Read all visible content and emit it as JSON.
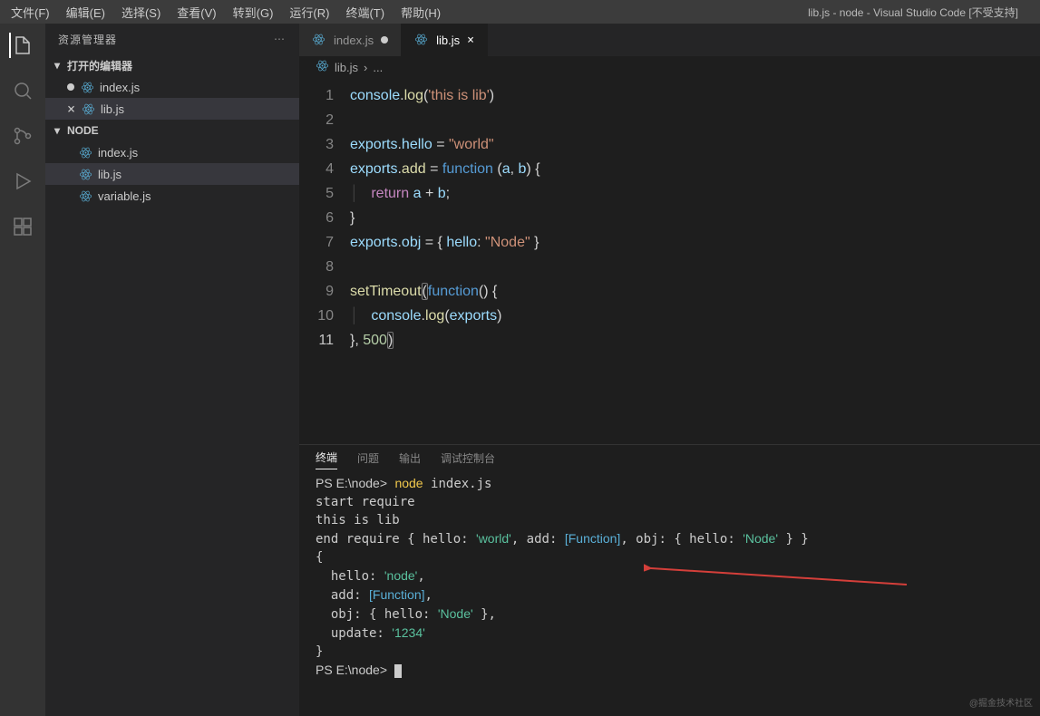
{
  "window": {
    "title": "lib.js - node - Visual Studio Code [不受支持]"
  },
  "menu": {
    "file": "文件(F)",
    "edit": "编辑(E)",
    "select": "选择(S)",
    "view": "查看(V)",
    "goto": "转到(G)",
    "run": "运行(R)",
    "terminal": "终端(T)",
    "help": "帮助(H)"
  },
  "sidebar": {
    "title": "资源管理器",
    "openEditors": {
      "label": "打开的编辑器",
      "items": [
        {
          "name": "index.js",
          "modified": true
        },
        {
          "name": "lib.js",
          "modified": false
        }
      ]
    },
    "folder": {
      "label": "NODE",
      "items": [
        {
          "name": "index.js"
        },
        {
          "name": "lib.js"
        },
        {
          "name": "variable.js"
        }
      ]
    }
  },
  "tabs": [
    {
      "name": "index.js",
      "modified": true,
      "active": false
    },
    {
      "name": "lib.js",
      "modified": false,
      "active": true
    }
  ],
  "breadcrumb": {
    "icon": "react",
    "file": "lib.js",
    "sep": "›",
    "tail": "..."
  },
  "code": {
    "lines": [
      {
        "n": 1,
        "html": "<span class='tok-obj'>console</span><span class='tok-pn'>.</span><span class='tok-fn'>log</span><span class='tok-pn'>(</span><span class='tok-str'>'this is lib'</span><span class='tok-pn'>)</span>"
      },
      {
        "n": 2,
        "html": ""
      },
      {
        "n": 3,
        "html": "<span class='tok-obj'>exports</span><span class='tok-pn'>.</span><span class='tok-obj'>hello</span> <span class='tok-pn'>=</span> <span class='tok-str'>\"world\"</span>"
      },
      {
        "n": 4,
        "html": "<span class='tok-obj'>exports</span><span class='tok-pn'>.</span><span class='tok-fn'>add</span> <span class='tok-pn'>=</span> <span class='tok-kw'>function</span> <span class='tok-pn'>(</span><span class='tok-obj'>a</span><span class='tok-pn'>,</span> <span class='tok-obj'>b</span><span class='tok-pn'>) {</span>"
      },
      {
        "n": 5,
        "html": "<span class='guide'>│   </span><span class='tok-kw2'>return</span> <span class='tok-obj'>a</span> <span class='tok-pn'>+</span> <span class='tok-obj'>b</span><span class='tok-pn'>;</span>"
      },
      {
        "n": 6,
        "html": "<span class='tok-pn'>}</span>"
      },
      {
        "n": 7,
        "html": "<span class='tok-obj'>exports</span><span class='tok-pn'>.</span><span class='tok-obj'>obj</span> <span class='tok-pn'>= {</span> <span class='tok-obj'>hello</span><span class='tok-pn'>:</span> <span class='tok-str'>\"Node\"</span> <span class='tok-pn'>}</span>"
      },
      {
        "n": 8,
        "html": ""
      },
      {
        "n": 9,
        "html": "<span class='tok-fn'>setTimeout</span><span class='tok-pn hl-br'>(</span><span class='tok-kw'>function</span><span class='tok-pn'>() {</span>"
      },
      {
        "n": 10,
        "html": "<span class='guide'>│   </span><span class='tok-obj'>console</span><span class='tok-pn'>.</span><span class='tok-fn'>log</span><span class='tok-pn'>(</span><span class='tok-obj'>exports</span><span class='tok-pn'>)</span>"
      },
      {
        "n": 11,
        "html": "<span class='tok-pn'>},</span> <span class='tok-num'>500</span><span class='tok-pn hl-br'>)</span>",
        "cur": true
      }
    ]
  },
  "panel": {
    "tabs": {
      "terminal": "终端",
      "problems": "问题",
      "output": "输出",
      "debug": "调试控制台"
    },
    "terminal": {
      "prompt": "PS E:\\node>",
      "cmd": "node",
      "arg": "index.js",
      "lines": [
        "start require",
        "this is lib"
      ],
      "endRequire": "end require",
      "obj1": "{ hello: 'world', add: [Function], obj: { hello: 'Node' } }",
      "out": {
        "hello": "'node'",
        "func": "[Function]",
        "objHello": "'Node'",
        "update": "'1234'"
      },
      "prompt2": "PS E:\\node>"
    }
  },
  "watermark": "@掘金技术社区"
}
